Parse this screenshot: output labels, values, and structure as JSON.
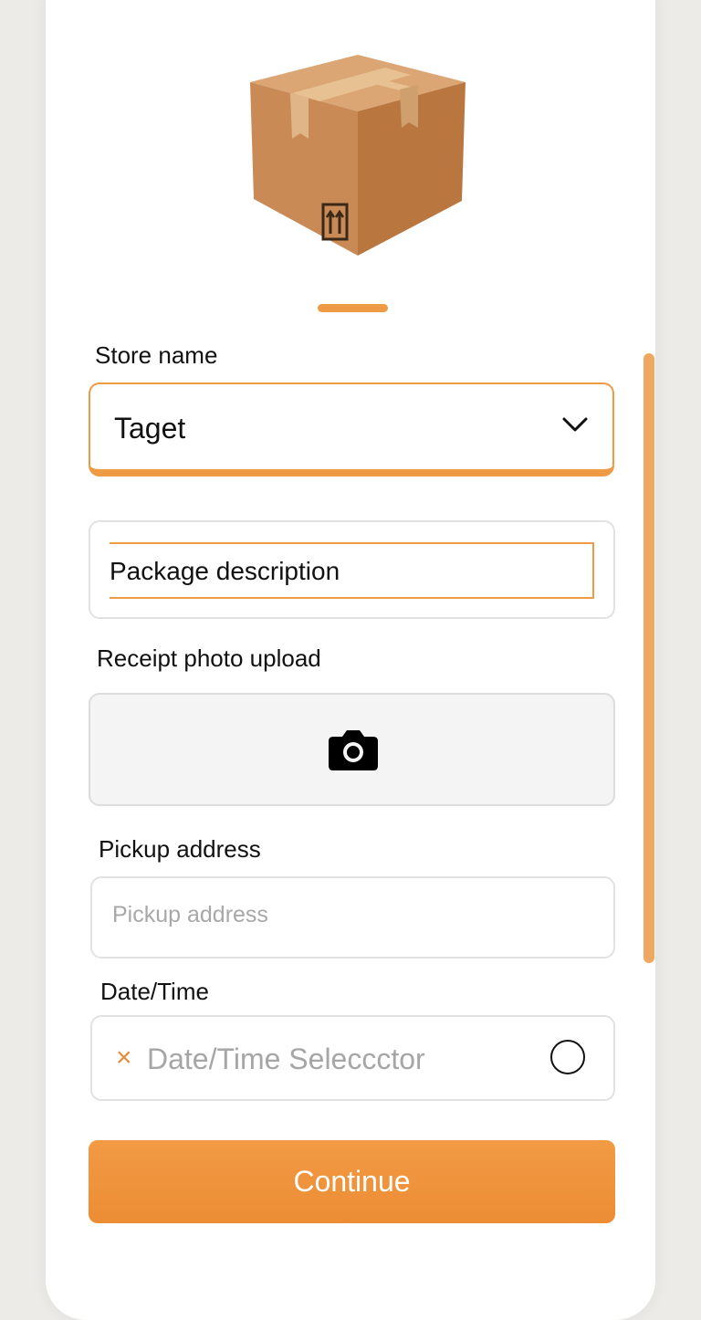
{
  "form": {
    "store_label": "Store name",
    "store_value": "Taget",
    "description_value": "Package description",
    "receipt_label": "Receipt photo upload",
    "pickup_label": "Pickup address",
    "pickup_placeholder": "Pickup address",
    "datetime_label": "Date/Time",
    "datetime_clear": "×",
    "datetime_value": "Date/Time Seleccctor",
    "continue_label": "Continue"
  },
  "icons": {
    "hero": "package-box-icon",
    "store_dropdown": "chevron-down-icon",
    "receipt": "camera-icon",
    "datetime_clear": "close-icon",
    "datetime_radio": "radio-icon"
  },
  "colors": {
    "accent": "#ef9a44",
    "button": "#ec8d34",
    "text": "#111111",
    "placeholder": "#a8a8a8",
    "border": "#e2e2e2",
    "upload_bg": "#f4f4f4"
  }
}
